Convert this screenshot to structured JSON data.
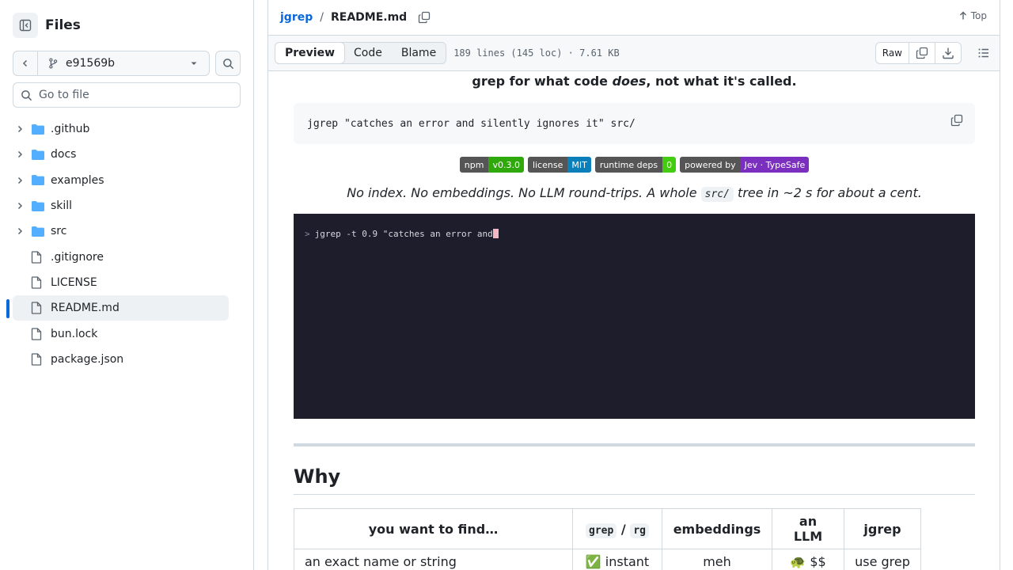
{
  "sidebar": {
    "title": "Files",
    "branch": "e91569b",
    "goto_placeholder": "Go to file",
    "items": [
      {
        "label": ".github",
        "type": "folder"
      },
      {
        "label": "docs",
        "type": "folder"
      },
      {
        "label": "examples",
        "type": "folder"
      },
      {
        "label": "skill",
        "type": "folder"
      },
      {
        "label": "src",
        "type": "folder"
      },
      {
        "label": ".gitignore",
        "type": "file"
      },
      {
        "label": "LICENSE",
        "type": "file"
      },
      {
        "label": "README.md",
        "type": "file",
        "selected": true
      },
      {
        "label": "bun.lock",
        "type": "file"
      },
      {
        "label": "package.json",
        "type": "file"
      }
    ]
  },
  "header": {
    "repo": "jgrep",
    "separator": "/",
    "file": "README.md",
    "top_label": "Top"
  },
  "toolbar": {
    "tabs": [
      "Preview",
      "Code",
      "Blame"
    ],
    "active_tab": "Preview",
    "file_info": "189 lines (145 loc) · 7.61 KB",
    "raw_label": "Raw"
  },
  "readme": {
    "tagline_pre": "grep for what code ",
    "tagline_em": "does",
    "tagline_post": ", not what it's called.",
    "code": "jgrep \"catches an error and silently ignores it\" src/",
    "badges": [
      {
        "left": "npm",
        "right": "v0.3.0",
        "color": "#2ea80b"
      },
      {
        "left": "license",
        "right": "MIT",
        "color": "#0a7fb9"
      },
      {
        "left": "runtime deps",
        "right": "0",
        "color": "#44cc11"
      },
      {
        "left": "powered by",
        "right": "Jev · TypeSafe",
        "color": "#7b2fbf"
      }
    ],
    "lead_pre": "No index. No embeddings. No LLM round-trips. A whole ",
    "lead_code": "src/",
    "lead_post": " tree in ~2 s for about a cent.",
    "terminal_prompt": ">",
    "terminal_text": "jgrep -t 0.9 \"catches an error and",
    "why_heading": "Why",
    "table": {
      "headers": [
        "you want to find…",
        "grep",
        "/",
        "rg",
        "embeddings",
        "an LLM",
        "jgrep"
      ],
      "rows": [
        [
          "an exact name or string",
          "✅ instant",
          "meh",
          "🐢 $$",
          "use grep"
        ]
      ]
    }
  },
  "colors": {
    "accent": "#0969da",
    "terminal_bg": "#1d1d2b",
    "folder": "#54aeff"
  }
}
